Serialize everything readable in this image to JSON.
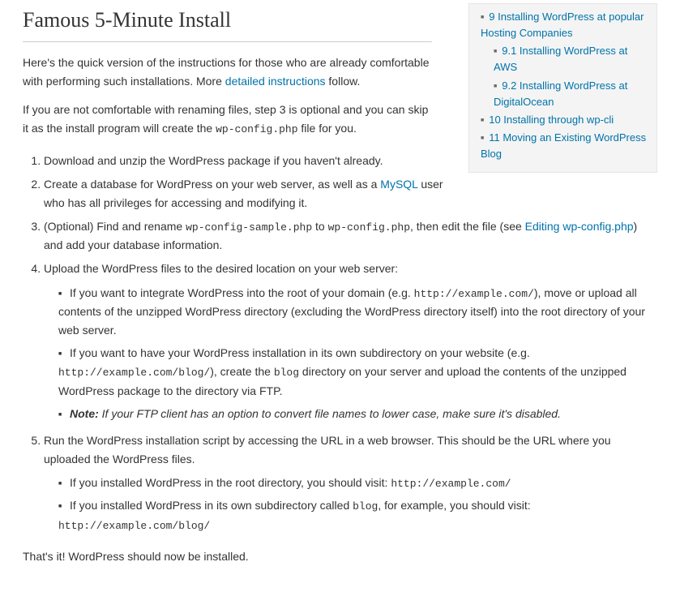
{
  "toc": {
    "items": [
      {
        "level": 1,
        "label": "9 Installing WordPress at popular Hosting Companies"
      },
      {
        "level": 2,
        "label": "9.1 Installing WordPress at AWS"
      },
      {
        "level": 2,
        "label": "9.2 Installing WordPress at DigitalOcean"
      },
      {
        "level": 1,
        "label": "10 Installing through wp-cli"
      },
      {
        "level": 1,
        "label": "11 Moving an Existing WordPress Blog"
      }
    ]
  },
  "heading": "Famous 5-Minute Install",
  "intro": {
    "part1": "Here's the quick version of the instructions for those who are already comfortable with performing such installations. More ",
    "link": "detailed instructions",
    "part2": " follow."
  },
  "comfort": {
    "part1": "If you are not comfortable with renaming files, step 3 is optional and you can skip it as the install program will create the ",
    "code": "wp-config.php",
    "part2": " file for you."
  },
  "steps": {
    "s1": "Download and unzip the WordPress package if you haven't already.",
    "s2": {
      "part1": "Create a database for WordPress on your web server, as well as a ",
      "link": "MySQL",
      "part2": " user who has all privileges for accessing and modifying it."
    },
    "s3": {
      "part1": "(Optional) Find and rename ",
      "code1": "wp-config-sample.php",
      "mid": " to ",
      "code2": "wp-config.php",
      "part2": ", then edit the file (see ",
      "link": "Editing wp-config.php",
      "part3": ") and add your database information."
    },
    "s4": {
      "lead": "Upload the WordPress files to the desired location on your web server:",
      "sub1": {
        "part1": "If you want to integrate WordPress into the root of your domain (e.g. ",
        "code": "http://example.com/",
        "part2": "), move or upload all contents of the unzipped WordPress directory (excluding the WordPress directory itself) into the root directory of your web server."
      },
      "sub2": {
        "part1": "If you want to have your WordPress installation in its own subdirectory on your website (e.g. ",
        "code1": "http://example.com/blog/",
        "mid": "), create the ",
        "code2": "blog",
        "part2": " directory on your server and upload the contents of the unzipped WordPress package to the directory via FTP."
      },
      "sub3": {
        "label": "Note:",
        "body": " If your FTP client has an option to convert file names to lower case, make sure it's disabled."
      }
    },
    "s5": {
      "lead": "Run the WordPress installation script by accessing the URL in a web browser. This should be the URL where you uploaded the WordPress files.",
      "sub1": {
        "part1": "If you installed WordPress in the root directory, you should visit: ",
        "code": "http://example.com/"
      },
      "sub2": {
        "part1": "If you installed WordPress in its own subdirectory called ",
        "code1": "blog",
        "mid": ", for example, you should visit: ",
        "code2": "http://example.com/blog/"
      }
    }
  },
  "outro": "That's it! WordPress should now be installed."
}
